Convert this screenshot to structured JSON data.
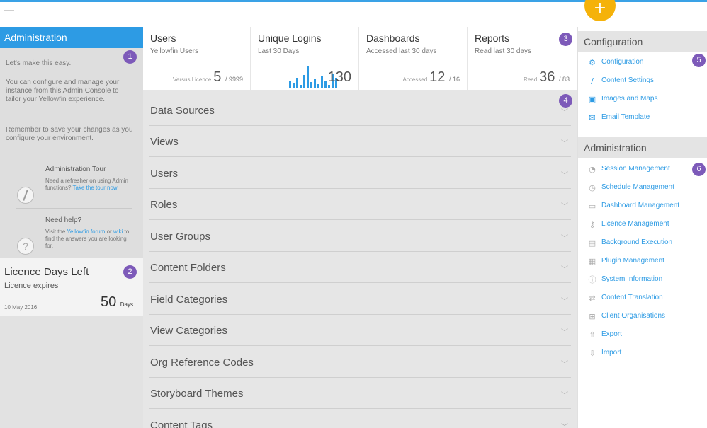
{
  "topbar": {
    "add_label": "+"
  },
  "left": {
    "admin_title": "Administration",
    "intro_line1": "Let's make this easy.",
    "intro_line2": "You can configure and manage your instance from this Admin Console to tailor your Yellowfin experience.",
    "intro_line3": "Remember to save your changes as you configure your environment.",
    "tour_title": "Administration Tour",
    "tour_text": "Need a refresher on using Admin functions?",
    "tour_link": "Take the tour now",
    "help_title": "Need help?",
    "help_text_pre": "Visit the",
    "help_link1": "Yellowfin forum",
    "help_text_mid": "or",
    "help_link2": "wiki",
    "help_text_post": "to find the answers you are looking for.",
    "licence_title": "Licence Days Left",
    "licence_sub": "Licence expires",
    "licence_date": "10 May 2016",
    "licence_days": "50",
    "licence_days_unit": "Days"
  },
  "badges": [
    "1",
    "2",
    "3",
    "4",
    "5",
    "6"
  ],
  "stats": [
    {
      "title": "Users",
      "sub": "Yellowfin Users",
      "label": "Versus Licence",
      "value": "5",
      "total": "/ 9999"
    },
    {
      "title": "Unique Logins",
      "sub": "Last 30 Days",
      "value": "130",
      "bars": [
        10,
        6,
        14,
        4,
        18,
        30,
        8,
        12,
        5,
        16,
        10,
        4,
        20,
        14
      ]
    },
    {
      "title": "Dashboards",
      "sub": "Accessed last 30 days",
      "label": "Accessed",
      "value": "12",
      "total": "/ 16"
    },
    {
      "title": "Reports",
      "sub": "Read last 30 days",
      "label": "Read",
      "value": "36",
      "total": "/ 83"
    }
  ],
  "sections": [
    "Data Sources",
    "Views",
    "Users",
    "Roles",
    "User Groups",
    "Content Folders",
    "Field Categories",
    "View Categories",
    "Org Reference Codes",
    "Storyboard Themes",
    "Content Tags"
  ],
  "chevron": "﹀",
  "right": {
    "config_title": "Configuration",
    "config_items": [
      {
        "label": "Configuration",
        "icon": "gear-icon"
      },
      {
        "label": "Content Settings",
        "icon": "brush-icon"
      },
      {
        "label": "Images and Maps",
        "icon": "image-icon"
      },
      {
        "label": "Email Template",
        "icon": "mail-icon"
      }
    ],
    "admin_title": "Administration",
    "admin_items": [
      {
        "label": "Session Management",
        "icon": "session-icon"
      },
      {
        "label": "Schedule Management",
        "icon": "clock-icon"
      },
      {
        "label": "Dashboard Management",
        "icon": "dashboard-icon"
      },
      {
        "label": "Licence Management",
        "icon": "key-icon"
      },
      {
        "label": "Background Execution",
        "icon": "background-icon"
      },
      {
        "label": "Plugin Management",
        "icon": "plugin-icon"
      },
      {
        "label": "System Information",
        "icon": "info-icon"
      },
      {
        "label": "Content Translation",
        "icon": "translate-icon"
      },
      {
        "label": "Client Organisations",
        "icon": "org-icon"
      },
      {
        "label": "Export",
        "icon": "export-icon"
      },
      {
        "label": "Import",
        "icon": "import-icon"
      }
    ]
  }
}
